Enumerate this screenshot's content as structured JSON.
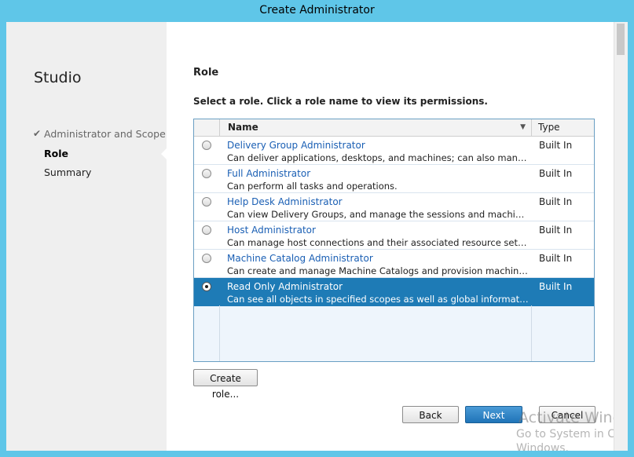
{
  "window": {
    "title": "Create Administrator"
  },
  "sidebar": {
    "heading": "Studio",
    "steps": [
      {
        "label": "Administrator and Scope",
        "state": "done"
      },
      {
        "label": "Role",
        "state": "current"
      },
      {
        "label": "Summary",
        "state": "pending"
      }
    ]
  },
  "main": {
    "section_title": "Role",
    "instructions": "Select a role. Click a role name to view its permissions.",
    "grid": {
      "columns": [
        "Name",
        "Type"
      ],
      "rows": [
        {
          "name": "Delivery Group Administrator",
          "description": "Can deliver applications, desktops, and machines; can also manage the…",
          "type": "Built In",
          "selected": false
        },
        {
          "name": "Full Administrator",
          "description": "Can perform all tasks and operations.",
          "type": "Built In",
          "selected": false
        },
        {
          "name": "Help Desk Administrator",
          "description": "Can view Delivery Groups, and manage the sessions and machines ass…",
          "type": "Built In",
          "selected": false
        },
        {
          "name": "Host Administrator",
          "description": "Can manage host connections and their associated resource settings.",
          "type": "Built In",
          "selected": false
        },
        {
          "name": "Machine Catalog Administrator",
          "description": "Can create and manage Machine Catalogs and provision machines.",
          "type": "Built In",
          "selected": false
        },
        {
          "name": "Read Only Administrator",
          "description": "Can see all objects in specified scopes as well as global information, b…",
          "type": "Built In",
          "selected": true
        }
      ]
    },
    "create_role_button": "Create role...",
    "buttons": {
      "back": "Back",
      "next": "Next",
      "cancel": "Cancel"
    }
  },
  "watermark": {
    "line1": "Activate Windows",
    "line2": "Go to System in Control",
    "line3": "Windows."
  },
  "colors": {
    "title_bar": "#5fc6e8",
    "selection": "#1e7bb6",
    "link": "#1a5fb4"
  }
}
